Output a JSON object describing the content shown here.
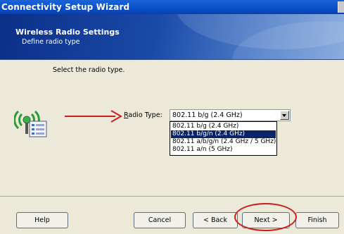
{
  "window": {
    "title": "Connectivity Setup Wizard"
  },
  "header": {
    "title": "Wireless Radio Settings",
    "subtitle": "Define radio type"
  },
  "content": {
    "instruction": "Select the radio type."
  },
  "radio_type": {
    "label_accel": "R",
    "label_rest": "adio Type:",
    "selected": "802.11 b/g (2.4 GHz)",
    "options": [
      "802.11 b/g (2.4 GHz)",
      "802.11 b/g/n (2.4 GHz)",
      "802.11 a/b/g/n (2.4 GHz / 5 GHz)",
      "802.11 a/n (5 GHz)"
    ],
    "highlighted_index": 1
  },
  "buttons": {
    "help": "Help",
    "cancel": "Cancel",
    "back": "< Back",
    "next": "Next >",
    "finish": "Finish"
  },
  "colors": {
    "annotation": "#cc1d1d",
    "selection": "#0a246a",
    "title_bar": "#0a4fc8"
  },
  "icons": [
    "wireless-router-icon",
    "dropdown-arrow-icon"
  ]
}
